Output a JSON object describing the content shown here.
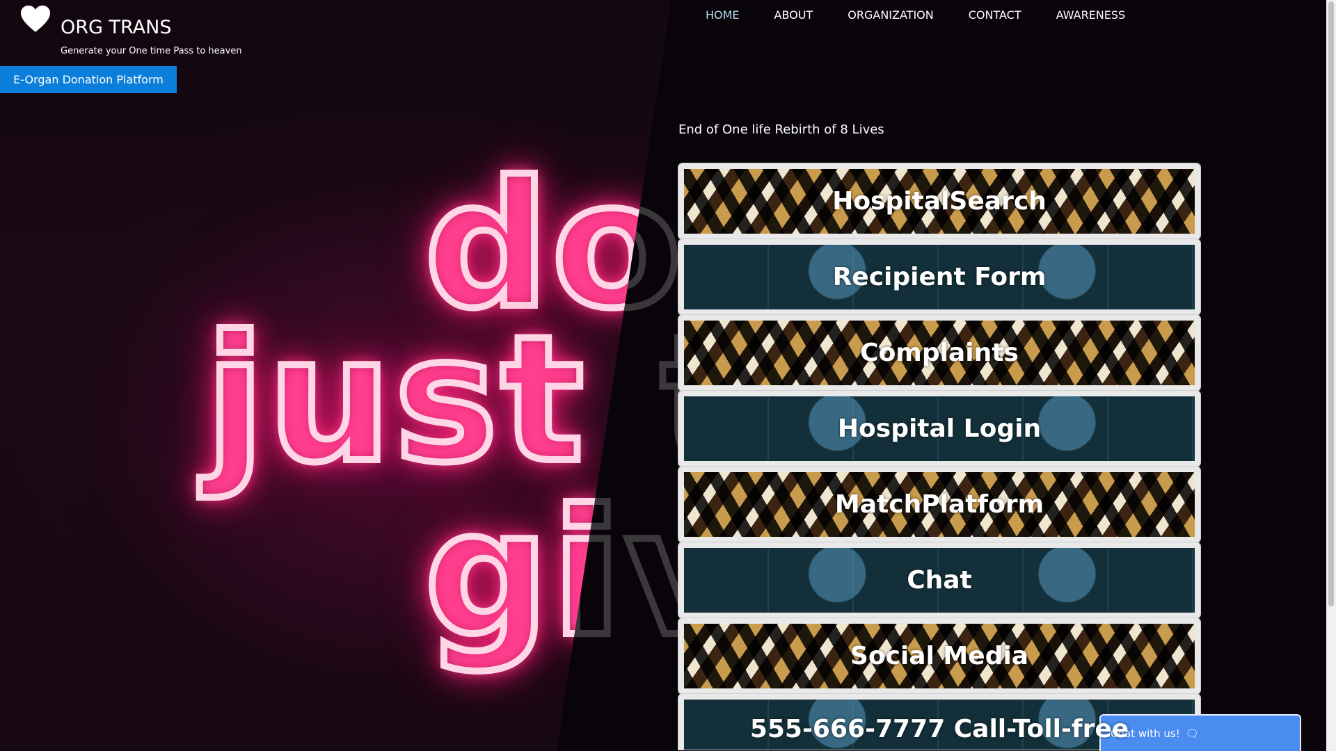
{
  "brand": {
    "title": "ORG TRANS",
    "subtitle": "Generate your One time Pass to heaven",
    "icon": "heart-icon"
  },
  "nav": {
    "items": [
      {
        "label": "HOME",
        "active": true
      },
      {
        "label": "ABOUT",
        "active": false
      },
      {
        "label": "ORGANIZATION",
        "active": false
      },
      {
        "label": "CONTACT",
        "active": false
      },
      {
        "label": "AWARENESS",
        "active": false
      }
    ]
  },
  "platform_button": "E-Organ Donation Platform",
  "tagline": "End of One life Rebirth of 8 Lives",
  "hero_neon": {
    "line1": "do",
    "line2": "just",
    "line3": "gi"
  },
  "tiles": [
    {
      "label": "HospitalSearch",
      "style": "gold"
    },
    {
      "label": "Recipient Form",
      "style": "teal"
    },
    {
      "label": "Complaints",
      "style": "gold"
    },
    {
      "label": "Hospital Login",
      "style": "teal"
    },
    {
      "label": "MatchPlatform",
      "style": "gold"
    },
    {
      "label": "Chat",
      "style": "teal"
    },
    {
      "label": "Social Media",
      "style": "gold"
    },
    {
      "label": "555-666-7777 Call-Toll-free",
      "style": "teal"
    }
  ],
  "chat_widget": {
    "label": "Chat with us!",
    "icon": "chat-bubbles-icon"
  },
  "colors": {
    "accent_blue": "#0b7dda",
    "chat_blue": "#4a8cf0",
    "nav_active": "#b5dcea"
  }
}
